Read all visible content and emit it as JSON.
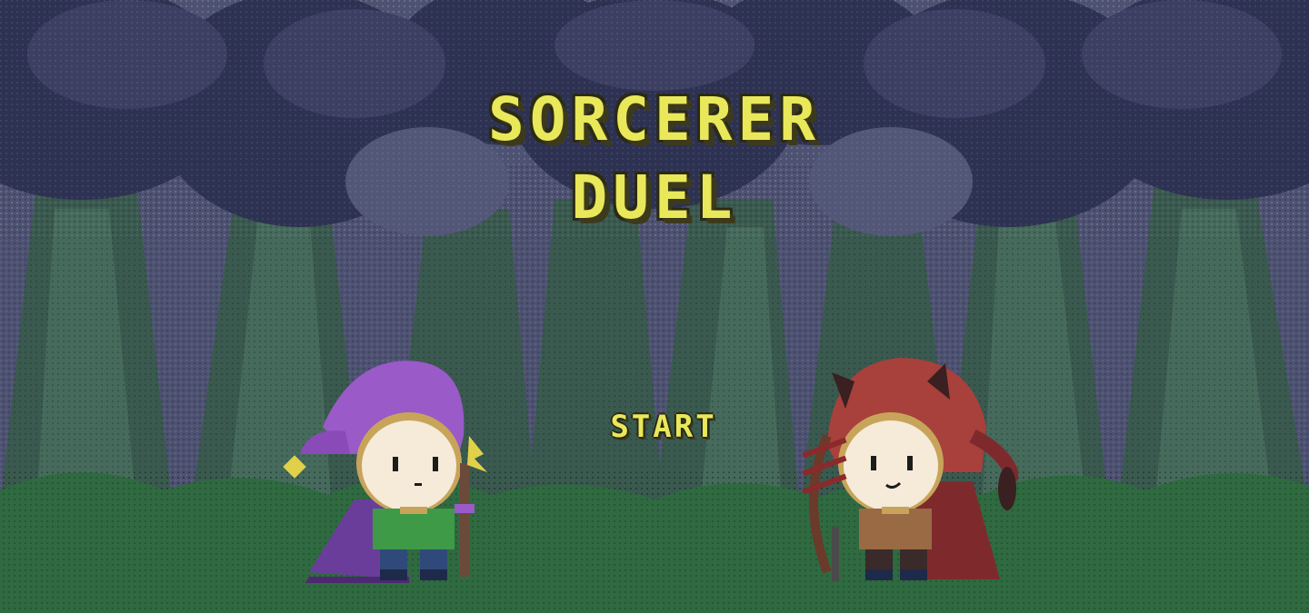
{
  "title": {
    "line1": "SORCERER",
    "line2": "DUEL"
  },
  "menu": {
    "start_label": "START"
  },
  "characters": [
    {
      "name_icon": "purple-wizard-icon",
      "color": "#9a5ac8"
    },
    {
      "name_icon": "red-hooded-archer-icon",
      "color": "#a8403c"
    }
  ],
  "colors": {
    "title_text": "#e9e85a",
    "title_outline": "#2b2a14",
    "sky": "#53577a",
    "canopy_dark": "#2f3354",
    "trunk": "#3f5d52",
    "grass": "#2f6a40"
  }
}
